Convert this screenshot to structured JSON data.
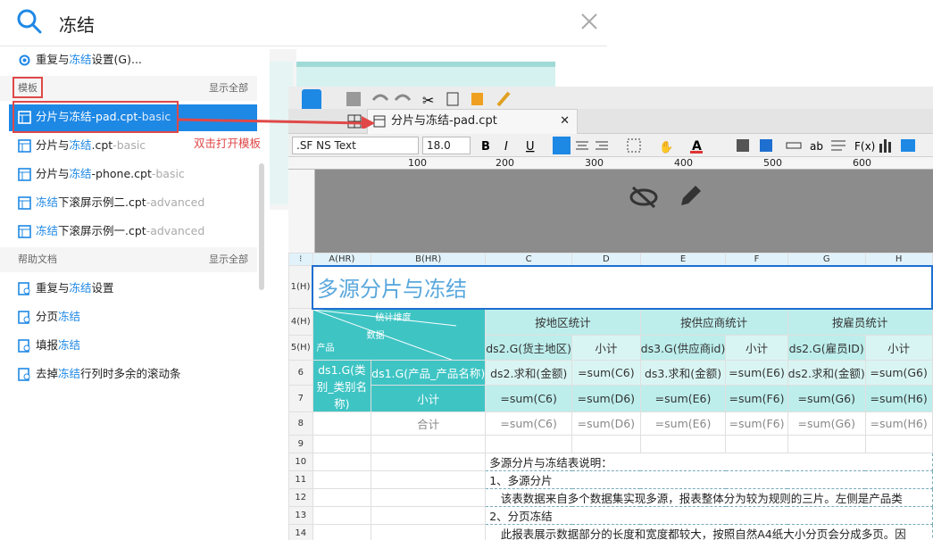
{
  "search": {
    "query": "冻结"
  },
  "top_result": {
    "prefix": "重复与",
    "highlight": "冻结",
    "suffix": "设置(G)..."
  },
  "templates": {
    "title": "模板",
    "show_all": "显示全部",
    "items": [
      {
        "pre": "分片与冻结-pad.cpt",
        "hl": "",
        "post": "",
        "tag": "-basic"
      },
      {
        "pre": "分片与",
        "hl": "冻结",
        "post": ".cpt",
        "tag": "-basic"
      },
      {
        "pre": "分片与",
        "hl": "冻结",
        "post": "-phone.cpt",
        "tag": "-basic"
      },
      {
        "pre": "",
        "hl": "冻结",
        "post": "下滚屏示例二.cpt",
        "tag": "-advanced"
      },
      {
        "pre": "",
        "hl": "冻结",
        "post": "下滚屏示例一.cpt",
        "tag": "-advanced"
      }
    ]
  },
  "help": {
    "title": "帮助文档",
    "show_all": "显示全部",
    "items": [
      {
        "pre": "重复与",
        "hl": "冻结",
        "post": "设置"
      },
      {
        "pre": "分页",
        "hl": "冻结",
        "post": ""
      },
      {
        "pre": "填报",
        "hl": "冻结",
        "post": ""
      },
      {
        "pre": "去掉",
        "hl": "冻结",
        "post": "行列时多余的滚动条"
      }
    ]
  },
  "callout": "双击打开模板",
  "designer": {
    "tab_label": "分片与冻结-pad.cpt",
    "font_name": ".SF NS Text",
    "font_size": "18.0",
    "ruler": [
      "100",
      "200",
      "300",
      "400",
      "500",
      "600"
    ],
    "columns": [
      "A(HR)",
      "B(HR)",
      "C",
      "D",
      "E",
      "F",
      "G",
      "H"
    ],
    "row_labels": [
      "1(H)",
      "4(H)",
      "5(H)",
      "6",
      "7",
      "8",
      "9",
      "10",
      "11",
      "12",
      "13",
      "14"
    ],
    "title": "多源分片与冻结",
    "diag": {
      "a": "统计维度",
      "b": "数据",
      "c": "产品"
    },
    "groups": [
      "按地区统计",
      "按供应商统计",
      "按雇员统计"
    ],
    "r5": [
      "ds2.G(货主地区)",
      "小计",
      "ds3.G(供应商id)",
      "小计",
      "ds2.G(雇员ID)",
      "小计"
    ],
    "r6": [
      "ds1.G(类别_类别名称)",
      "ds1.G(产品_产品名称)",
      "ds2.求和(金额)",
      "=sum(C6)",
      "ds3.求和(金额)",
      "=sum(E6)",
      "ds2.求和(金额)",
      "=sum(G6)"
    ],
    "r7": [
      "小计",
      "=sum(C6)",
      "=sum(D6)",
      "=sum(E6)",
      "=sum(F6)",
      "=sum(G6)",
      "=sum(H6)"
    ],
    "r8": [
      "合计",
      "=sum(C6)",
      "=sum(D6)",
      "=sum(E6)",
      "=sum(F6)",
      "=sum(G6)",
      "=sum(H6)"
    ],
    "notes": [
      "多源分片与冻结表说明：",
      "1、多源分片",
      "　该表数据来自多个数据集实现多源，报表整体分为较为规则的三片。左侧是产品类",
      "2、分页冻结",
      "　此报表展示数据部分的长度和宽度都较大，按照自然A4纸大小分页会分成多页。因"
    ]
  }
}
